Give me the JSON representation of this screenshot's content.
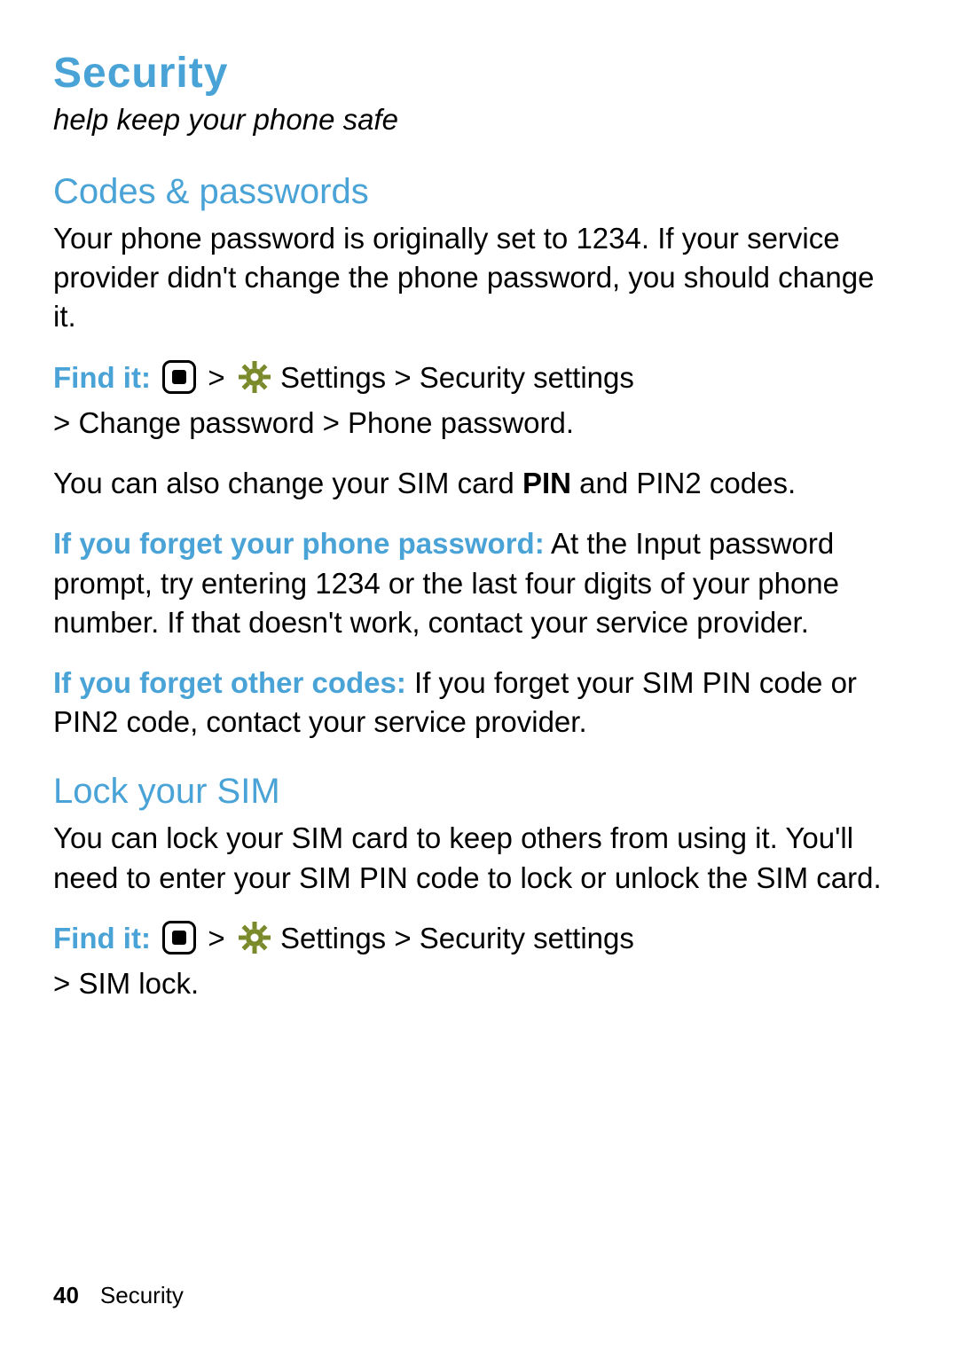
{
  "title": "Security",
  "subtitle": "help keep your phone safe",
  "section1": {
    "heading": "Codes & passwords",
    "p1": "Your phone password is originally set to 1234. If your service provider didn't change the phone password, you should change it.",
    "findit_label": "Find it:",
    "findit_path1a": " Settings > Security settings",
    "findit_path1b": "> Change password > Phone password.",
    "p2a": "You can also change your SIM card ",
    "p2pin": "PIN",
    "p2b": " and PIN2 codes.",
    "forgot_phone_label": "If you forget your phone password:",
    "forgot_phone_text": " At the Input password prompt, try entering 1234 or the last four digits of your phone number. If that doesn't work, contact your service provider.",
    "forgot_other_label": "If you forget other codes:",
    "forgot_other_text": " If you forget your SIM PIN code or PIN2 code, contact your service provider."
  },
  "section2": {
    "heading": "Lock your SIM",
    "p1": "You can lock your SIM card to keep others from using it. You'll need to enter your SIM PIN code to lock or unlock the SIM card.",
    "findit_label": "Find it: ",
    "findit_path2a": " Settings > Security settings",
    "findit_path2b": "> SIM lock."
  },
  "footer": {
    "page_number": "40",
    "section_name": "Security"
  },
  "breadcrumb_sep": " > "
}
